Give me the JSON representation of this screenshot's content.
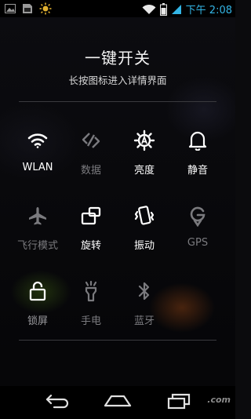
{
  "status_bar": {
    "time": "下午 2:08",
    "icons": [
      "image-icon",
      "sim-card-icon",
      "brightness-icon",
      "wifi-icon",
      "battery-icon",
      "signal-icon"
    ],
    "accent_color": "#33b5e5"
  },
  "panel": {
    "title": "一键开关",
    "subtitle": "长按图标进入详情界面"
  },
  "toggles": [
    {
      "label": "WLAN",
      "icon": "wifi-icon",
      "state": "on"
    },
    {
      "label": "数据",
      "icon": "data-sync-icon",
      "state": "off"
    },
    {
      "label": "亮度",
      "icon": "brightness-auto-icon",
      "state": "on"
    },
    {
      "label": "静音",
      "icon": "bell-icon",
      "state": "on"
    },
    {
      "label": "飞行模式",
      "icon": "airplane-icon",
      "state": "off"
    },
    {
      "label": "旋转",
      "icon": "rotate-icon",
      "state": "on"
    },
    {
      "label": "振动",
      "icon": "vibrate-icon",
      "state": "on"
    },
    {
      "label": "GPS",
      "icon": "gps-icon",
      "state": "off"
    },
    {
      "label": "锁屏",
      "icon": "unlock-icon",
      "state": "on"
    },
    {
      "label": "手电",
      "icon": "flashlight-icon",
      "state": "off"
    },
    {
      "label": "蓝牙",
      "icon": "bluetooth-icon",
      "state": "off"
    }
  ],
  "nav_bar": {
    "buttons": [
      "back-icon",
      "home-icon",
      "recents-icon"
    ],
    "watermark": ".com"
  }
}
